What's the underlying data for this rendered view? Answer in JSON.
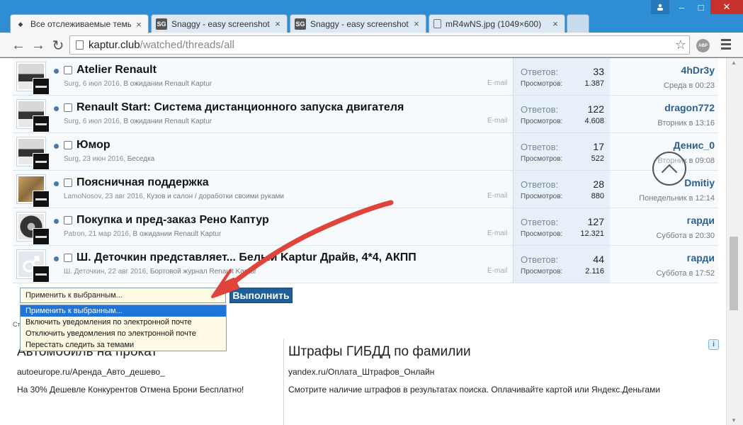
{
  "browser": {
    "tabs": [
      {
        "label": "Все отслеживаемые темы",
        "favicon": "renault-logo"
      },
      {
        "label": "Snaggy - easy screenshots",
        "favicon": "SG"
      },
      {
        "label": "Snaggy - easy screenshots",
        "favicon": "SG"
      },
      {
        "label": "mR4wNS.jpg (1049×600)",
        "favicon": "page-icon"
      }
    ],
    "close_glyph": "×",
    "url_host": "kaptur.club",
    "url_path": "/watched/threads/all",
    "abp_label": "ABP",
    "window_controls": {
      "min": "–",
      "max": "□",
      "close": "✕"
    }
  },
  "threads": [
    {
      "title": "Atelier Renault",
      "author": "Surg",
      "date": "6 июл 2016",
      "forum": "В ожидании Renault Kaptur",
      "email": "E-mail",
      "replies_label": "Ответов:",
      "replies": "33",
      "views_label": "Просмотров:",
      "views": "1.387",
      "last_user": "4hDr3y",
      "last_date": "Среда в 00:23",
      "avatar": "car-dark"
    },
    {
      "title": "Renault Start: Система дистанционного запуска двигателя",
      "author": "Surg",
      "date": "6 июл 2016",
      "forum": "В ожидании Renault Kaptur",
      "email": "E-mail",
      "replies_label": "Ответов:",
      "replies": "122",
      "views_label": "Просмотров:",
      "views": "4.608",
      "last_user": "dragon772",
      "last_date": "Вторник в 13:16",
      "avatar": "car-dark"
    },
    {
      "title": "Юмор",
      "author": "Surg",
      "date": "23 июн 2016",
      "forum": "Беседка",
      "email": "",
      "replies_label": "Ответов:",
      "replies": "17",
      "views_label": "Просмотров:",
      "views": "522",
      "last_user": "Денис_0",
      "last_date": "Вторник в 09:08",
      "avatar": "car-dark"
    },
    {
      "title": "Поясничная поддержка",
      "author": "LamoNosov",
      "date": "23 авг 2016",
      "forum": "Кузов и салон / доработки своими руками",
      "email": "E-mail",
      "replies_label": "Ответов:",
      "replies": "28",
      "views_label": "Просмотров:",
      "views": "880",
      "last_user": "Dmitiy",
      "last_date": "Понедельник в 12:14",
      "avatar": "photo-person"
    },
    {
      "title": "Покупка и пред-заказ Рено Каптур",
      "author": "Patron",
      "date": "21 мар 2016",
      "forum": "В ожидании Renault Kaptur",
      "email": "E-mail",
      "replies_label": "Ответов:",
      "replies": "127",
      "views_label": "Просмотров:",
      "views": "12.321",
      "last_user": "гарди",
      "last_date": "Суббота в 20:30",
      "avatar": "wheel"
    },
    {
      "title": "Ш. Деточкин представляет... Белый Kaptur Драйв, 4*4, АКПП",
      "author": "Ш. Деточкин",
      "date": "22 авг 2016",
      "forum": "Бортовой журнал Renault Kaptur",
      "email": "E-mail",
      "replies_label": "Ответов:",
      "replies": "44",
      "views_label": "Просмотров:",
      "views": "2.116",
      "last_user": "гарди",
      "last_date": "Суббота в 17:52",
      "avatar": "default-male"
    }
  ],
  "bulk": {
    "select_value": "Применить к выбранным...",
    "run_label": "Выполнить",
    "options": [
      "Применить к выбранным...",
      "Включить уведомления по электронной почте",
      "Отключить уведомления по электронной почте",
      "Перестать следить за темами"
    ],
    "hidden_text": "Ст"
  },
  "ads": [
    {
      "headline": "Автомобиль на прокат",
      "url": "autoeurope.ru/Аренда_Авто_дешево_",
      "desc": "На 30% Дешевле Конкурентов Отмена Брони Бесплатно!"
    },
    {
      "headline": "Штрафы ГИБДД по фамилии",
      "url": "yandex.ru/Оплата_Штрафов_Онлайн",
      "desc": "Смотрите наличие штрафов в результатах поиска. Оплачивайте картой или Яндекс.Деньгами"
    }
  ],
  "ad_info_glyph": "i",
  "colors": {
    "accent": "#1f5e96",
    "annotation": "#e0433a",
    "selected_option": "#1e74d9"
  }
}
